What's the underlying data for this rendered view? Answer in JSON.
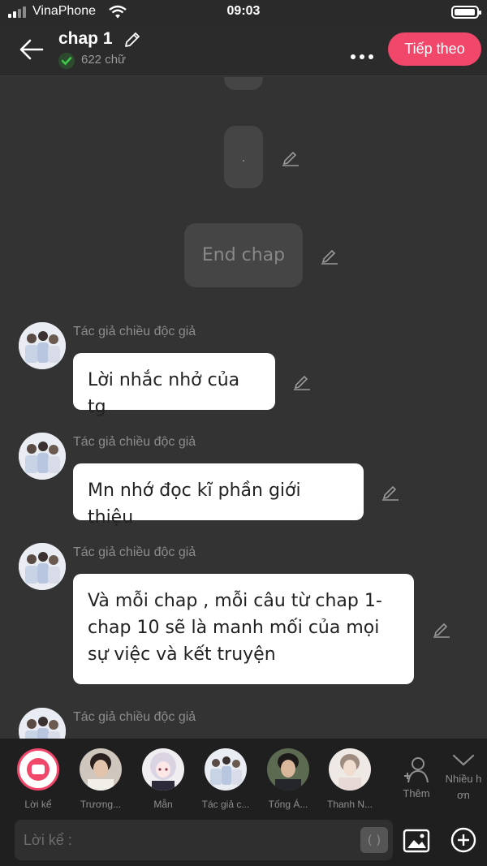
{
  "status": {
    "carrier": "VinaPhone",
    "time": "09:03"
  },
  "header": {
    "title": "chap 1",
    "word_count": "622 chữ",
    "next_label": "Tiếp theo"
  },
  "narration": {
    "dot": ".",
    "end": "End chap"
  },
  "messages": [
    {
      "speaker": "Tác giả chiều độc giả",
      "text": "Lời nhắc nhở của tg"
    },
    {
      "speaker": "Tác giả chiều độc giả",
      "text": "Mn nhớ đọc kĩ phần giới thiệu"
    },
    {
      "speaker": "Tác giả chiều độc giả",
      "text": "Và mỗi chap , mỗi câu từ chap 1-chap 10 sẽ là manh mối của mọi sự việc và kết truyện"
    },
    {
      "speaker": "Tác giả chiều độc giả",
      "text": ""
    }
  ],
  "characters": [
    {
      "name": "Lời kể",
      "icon": "narrator-icon"
    },
    {
      "name": "Trương...",
      "icon": "avatar"
    },
    {
      "name": "Mẫn",
      "icon": "avatar"
    },
    {
      "name": "Tác giả c...",
      "icon": "avatar"
    },
    {
      "name": "Tống Á...",
      "icon": "avatar"
    },
    {
      "name": "Thanh N...",
      "icon": "avatar"
    }
  ],
  "more_characters": {
    "add_label": "Thêm",
    "multi_line1": "Nhiều h",
    "multi_line2": "ơn"
  },
  "composer": {
    "placeholder": "Lời kể :",
    "emoji_glyph": "( )"
  },
  "colors": {
    "accent": "#f0476b",
    "background": "#333333",
    "bubble": "#ffffff",
    "narration_bg": "#454545"
  }
}
